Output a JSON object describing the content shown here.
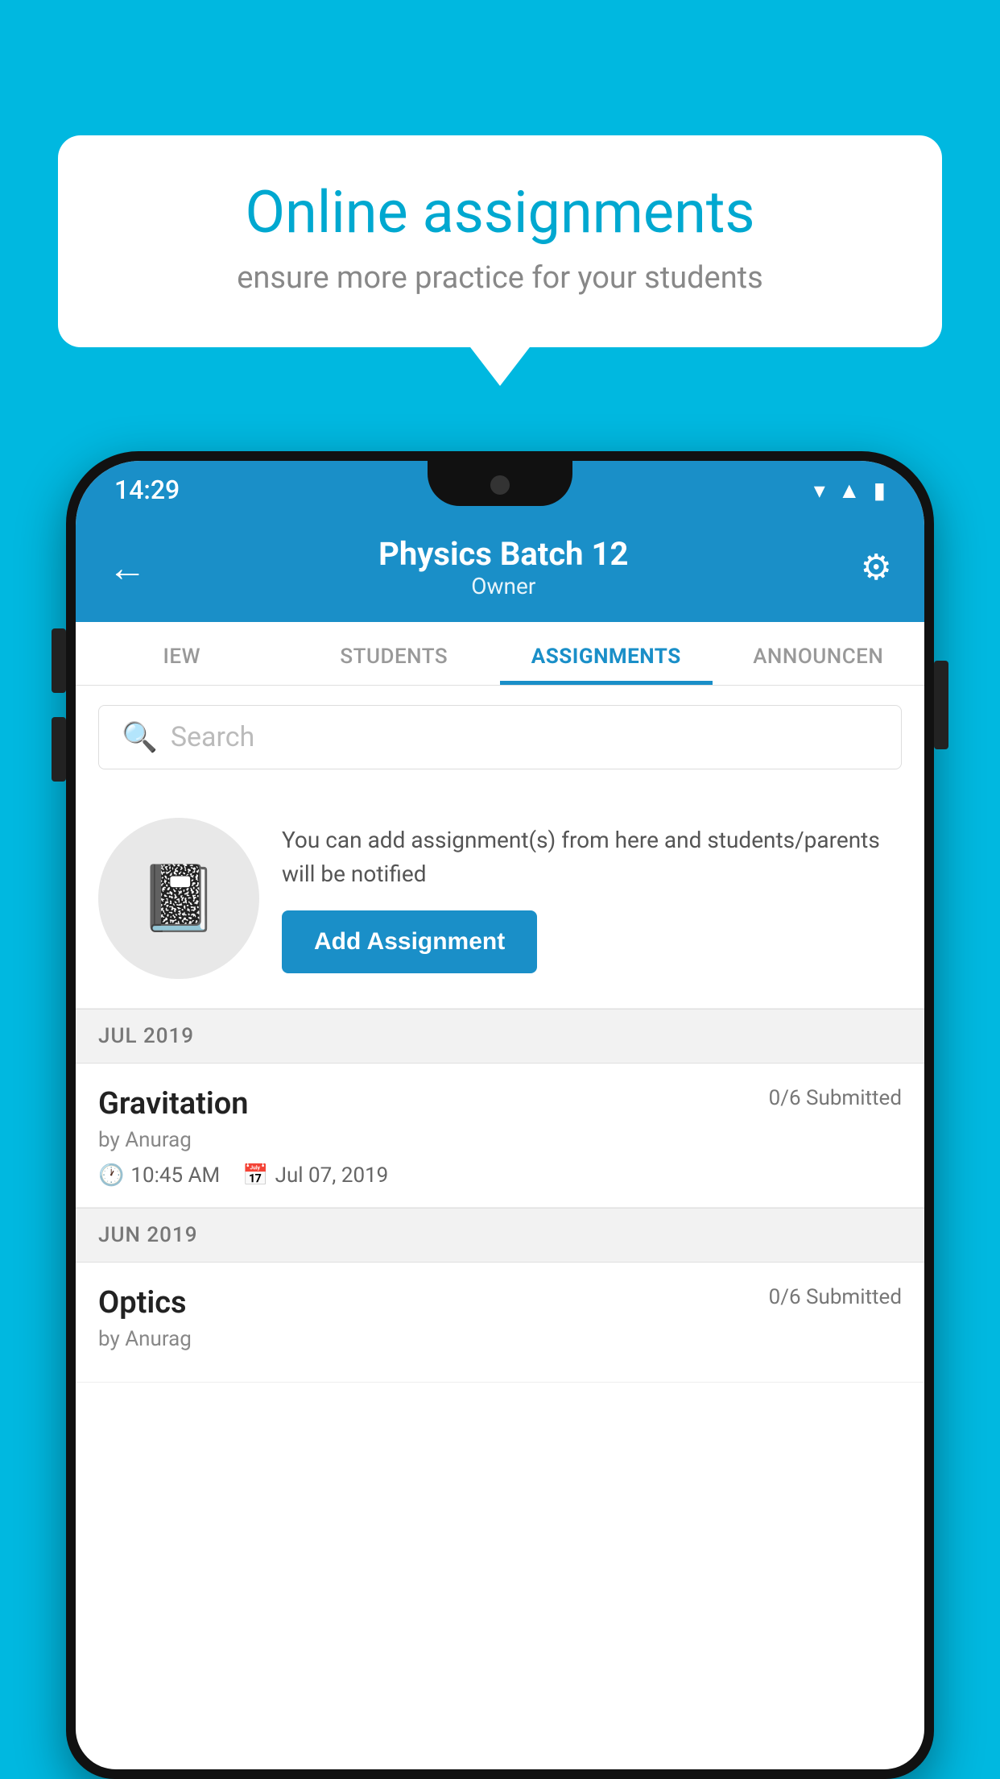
{
  "background": {
    "color": "#00b8e0"
  },
  "speech_bubble": {
    "title": "Online assignments",
    "subtitle": "ensure more practice for your students"
  },
  "status_bar": {
    "time": "14:29",
    "icons": [
      "wifi",
      "signal",
      "battery"
    ]
  },
  "app_header": {
    "title": "Physics Batch 12",
    "subtitle": "Owner",
    "back_label": "←",
    "settings_label": "⚙"
  },
  "tabs": [
    {
      "label": "IEW",
      "active": false
    },
    {
      "label": "STUDENTS",
      "active": false
    },
    {
      "label": "ASSIGNMENTS",
      "active": true
    },
    {
      "label": "ANNOUNCEN",
      "active": false
    }
  ],
  "search": {
    "placeholder": "Search"
  },
  "promo": {
    "text": "You can add assignment(s) from here and students/parents will be notified",
    "button_label": "Add Assignment"
  },
  "sections": [
    {
      "header": "JUL 2019",
      "assignments": [
        {
          "name": "Gravitation",
          "submitted": "0/6 Submitted",
          "by": "by Anurag",
          "time": "10:45 AM",
          "date": "Jul 07, 2019"
        }
      ]
    },
    {
      "header": "JUN 2019",
      "assignments": [
        {
          "name": "Optics",
          "submitted": "0/6 Submitted",
          "by": "by Anurag",
          "time": "",
          "date": ""
        }
      ]
    }
  ]
}
